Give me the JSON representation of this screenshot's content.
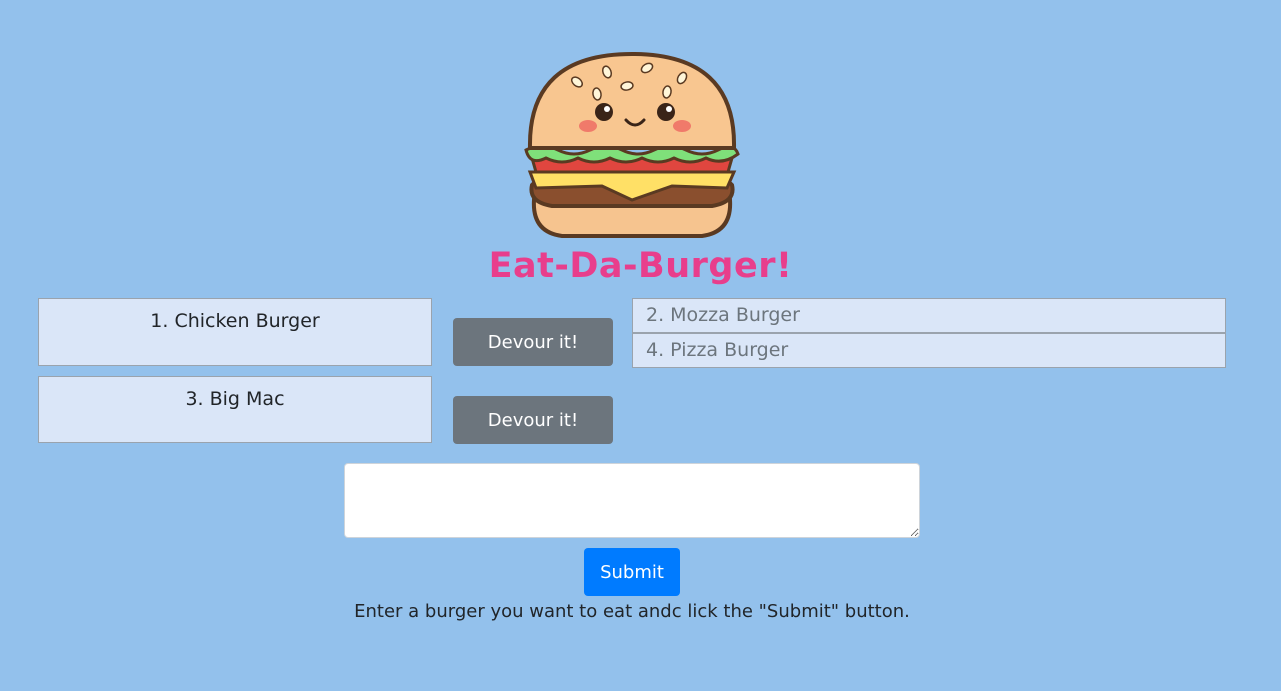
{
  "header": {
    "logo_icon": "cartoon-burger-icon",
    "title": "Eat-Da-Burger!",
    "title_color": "#e83e8c"
  },
  "burgers_to_eat": [
    {
      "label": "1. Chicken Burger",
      "button_label": "Devour it!"
    },
    {
      "label": "3. Big Mac",
      "button_label": "Devour it!"
    }
  ],
  "devoured_burgers": [
    {
      "label": "2. Mozza Burger"
    },
    {
      "label": "4. Pizza Burger"
    }
  ],
  "form": {
    "input_value": "",
    "submit_label": "Submit",
    "instructions": "Enter a burger you want to eat andc lick the \"Submit\" button."
  },
  "colors": {
    "background": "#93c1ec",
    "devour_button": "#6c757d",
    "submit_button": "#007bff",
    "list_item_bg": "#dae6f8"
  }
}
